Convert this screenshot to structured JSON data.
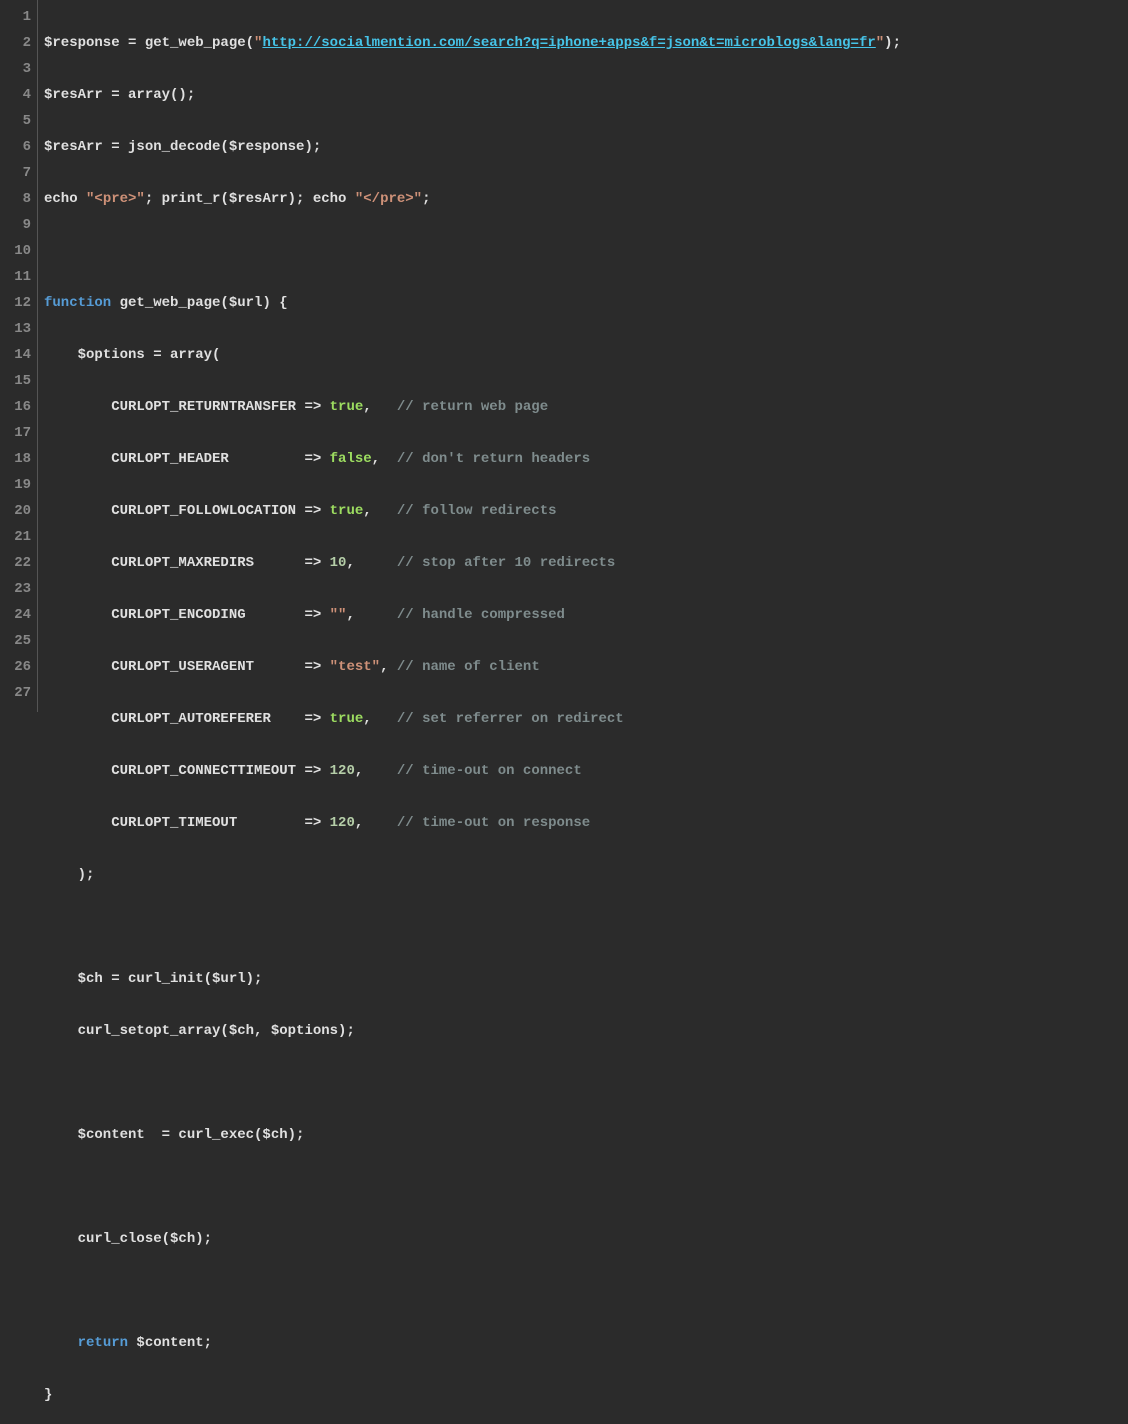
{
  "gutter": {
    "lines": [
      "1",
      "2",
      "3",
      "4",
      "5",
      "6",
      "7",
      "8",
      "9",
      "10",
      "11",
      "12",
      "13",
      "14",
      "15",
      "16",
      "17",
      "18",
      "19",
      "20",
      "21",
      "22",
      "23",
      "24",
      "25",
      "26",
      "27"
    ]
  },
  "code": {
    "line1": {
      "p1": "$response = get_web_page(",
      "q1": "\"",
      "url": "http://socialmention.com/search?q=iphone+apps&f=json&t=microblogs&lang=fr",
      "q2": "\"",
      "p2": ");"
    },
    "line2": "$resArr = array();",
    "line3": "$resArr = json_decode($response);",
    "line4": {
      "p1": "echo ",
      "s1": "\"<pre>\"",
      "p2": "; print_r($resArr); echo ",
      "s2": "\"</pre>\"",
      "p3": ";"
    },
    "line5": "",
    "line6": {
      "kw": "function",
      "name": " get_web_page($url) {"
    },
    "line7": "    $options = array(",
    "line8": {
      "pad": "        ",
      "c": "CURLOPT_RETURNTRANSFER => ",
      "v": "true",
      "comma": ",   ",
      "cm": "// return web page"
    },
    "line9": {
      "pad": "        ",
      "c": "CURLOPT_HEADER         => ",
      "v": "false",
      "comma": ",  ",
      "cm": "// don't return headers"
    },
    "line10": {
      "pad": "        ",
      "c": "CURLOPT_FOLLOWLOCATION => ",
      "v": "true",
      "comma": ",   ",
      "cm": "// follow redirects"
    },
    "line11": {
      "pad": "        ",
      "c": "CURLOPT_MAXREDIRS      => ",
      "v": "10",
      "comma": ",     ",
      "cm": "// stop after 10 redirects"
    },
    "line12": {
      "pad": "        ",
      "c": "CURLOPT_ENCODING       => ",
      "v": "\"\"",
      "comma": ",     ",
      "cm": "// handle compressed"
    },
    "line13": {
      "pad": "        ",
      "c": "CURLOPT_USERAGENT      => ",
      "v": "\"test\"",
      "comma": ", ",
      "cm": "// name of client"
    },
    "line14": {
      "pad": "        ",
      "c": "CURLOPT_AUTOREFERER    => ",
      "v": "true",
      "comma": ",   ",
      "cm": "// set referrer on redirect"
    },
    "line15": {
      "pad": "        ",
      "c": "CURLOPT_CONNECTTIMEOUT => ",
      "v": "120",
      "comma": ",    ",
      "cm": "// time-out on connect"
    },
    "line16": {
      "pad": "        ",
      "c": "CURLOPT_TIMEOUT        => ",
      "v": "120",
      "comma": ",    ",
      "cm": "// time-out on response"
    },
    "line17": "    );",
    "line18": "",
    "line19": "    $ch = curl_init($url);",
    "line20": "    curl_setopt_array($ch, $options);",
    "line21": "",
    "line22": "    $content  = curl_exec($ch);",
    "line23": "",
    "line24": "    curl_close($ch);",
    "line25": "",
    "line26": {
      "pad": "    ",
      "kw": "return",
      "rest": " $content;"
    },
    "line27": "}"
  }
}
